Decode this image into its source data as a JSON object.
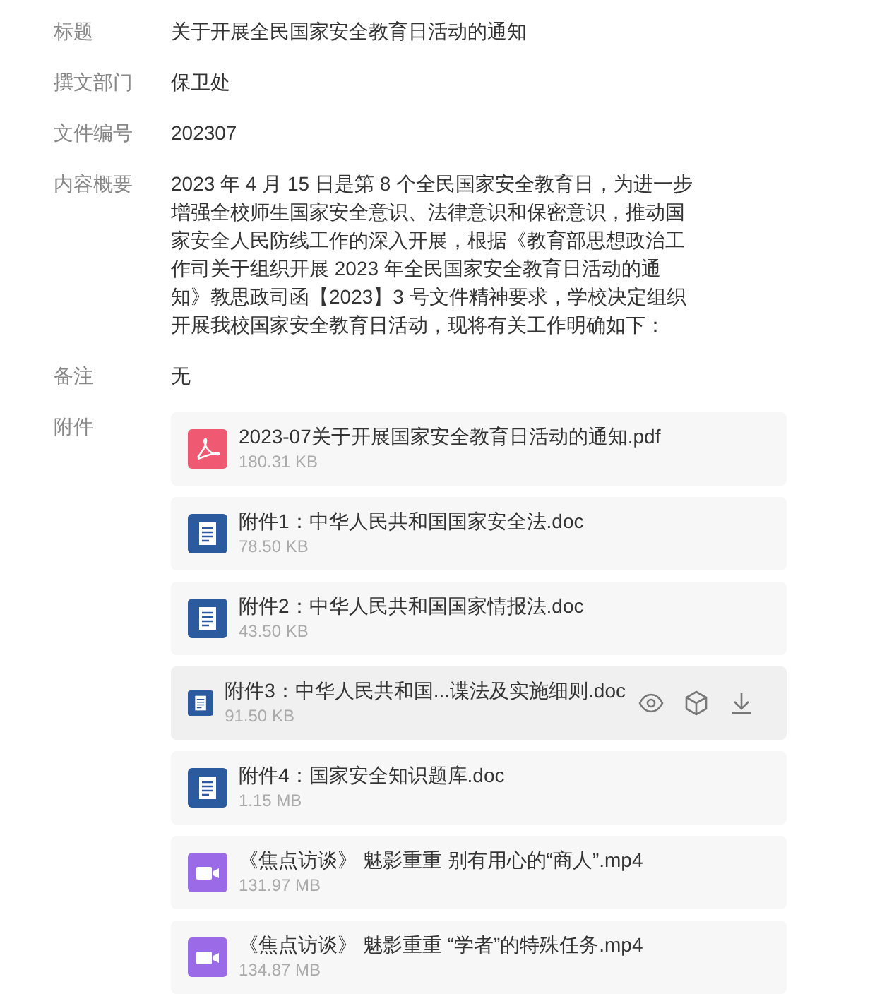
{
  "fields": [
    {
      "label": "标题",
      "value": "关于开展全民国家安全教育日活动的通知"
    },
    {
      "label": "撰文部门",
      "value": "保卫处"
    },
    {
      "label": "文件编号",
      "value": "202307"
    },
    {
      "label": "内容概要",
      "value": "2023 年 4 月 15 日是第 8 个全民国家安全教育日，为进一步增强全校师生国家安全意识、法律意识和保密意识，推动国家安全人民防线工作的深入开展，根据《教育部思想政治工作司关于组织开展 2023 年全民国家安全教育日活动的通知》教思政司函【2023】3 号文件精神要求，学校决定组织开展我校国家安全教育日活动，现将有关工作明确如下："
    },
    {
      "label": "备注",
      "value": "无"
    }
  ],
  "attachments_label": "附件",
  "attachments": [
    {
      "kind": "pdf",
      "name": "2023-07关于开展国家安全教育日活动的通知.pdf",
      "size": "180.31 KB",
      "hovered": false
    },
    {
      "kind": "doc",
      "name": "附件1：中华人民共和国国家安全法.doc",
      "size": "78.50 KB",
      "hovered": false
    },
    {
      "kind": "doc",
      "name": "附件2：中华人民共和国国家情报法.doc",
      "size": "43.50 KB",
      "hovered": false
    },
    {
      "kind": "doc",
      "name": "附件3：中华人民共和国...谍法及实施细则.doc",
      "size": "91.50 KB",
      "hovered": true
    },
    {
      "kind": "doc",
      "name": "附件4：国家安全知识题库.doc",
      "size": "1.15 MB",
      "hovered": false
    },
    {
      "kind": "video",
      "name": "《焦点访谈》 魅影重重 别有用心的“商人”.mp4",
      "size": "131.97 MB",
      "hovered": false
    },
    {
      "kind": "video",
      "name": "《焦点访谈》 魅影重重 “学者”的特殊任务.mp4",
      "size": "134.87 MB",
      "hovered": false
    }
  ]
}
